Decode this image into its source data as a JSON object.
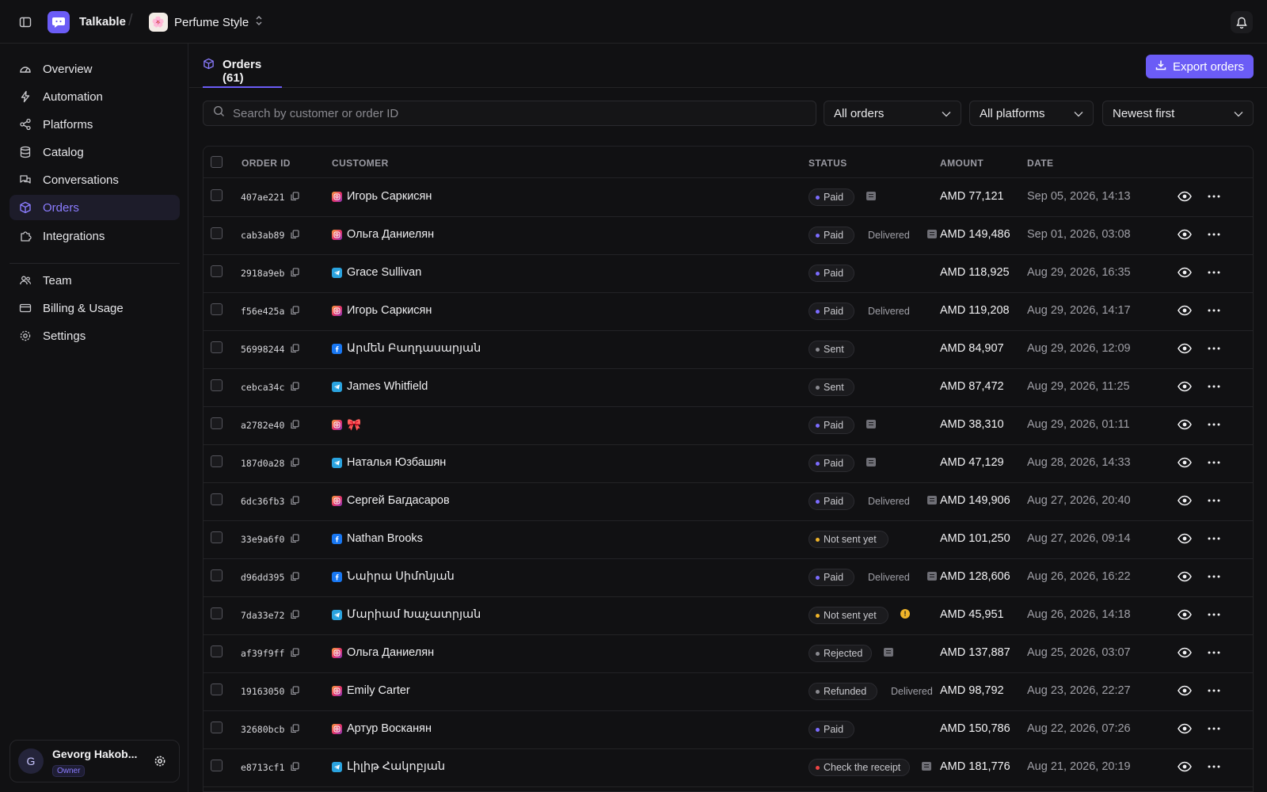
{
  "topbar": {
    "app_name": "Talkable",
    "store_name": "Perfume Style",
    "store_avatar": "🌸"
  },
  "sidebar": {
    "items": [
      {
        "label": "Overview",
        "icon": "gauge-icon"
      },
      {
        "label": "Automation",
        "icon": "bolt-icon"
      },
      {
        "label": "Platforms",
        "icon": "share-icon"
      },
      {
        "label": "Catalog",
        "icon": "database-icon"
      },
      {
        "label": "Conversations",
        "icon": "chat-icon"
      },
      {
        "label": "Orders",
        "icon": "box-icon",
        "active": true
      },
      {
        "label": "Integrations",
        "icon": "puzzle-icon"
      },
      {
        "label": "Team",
        "icon": "users-icon"
      },
      {
        "label": "Billing & Usage",
        "icon": "card-icon"
      },
      {
        "label": "Settings",
        "icon": "gear-icon"
      }
    ],
    "user": {
      "initial": "G",
      "name": "Gevorg Hakob...",
      "role": "Owner"
    }
  },
  "header": {
    "tab_label": "Orders (61)",
    "export_label": "Export orders"
  },
  "filters": {
    "search_placeholder": "Search by customer or order ID",
    "status_filter": "All orders",
    "platform_filter": "All platforms",
    "sort": "Newest first"
  },
  "table": {
    "columns": [
      "ORDER ID",
      "CUSTOMER",
      "STATUS",
      "AMOUNT",
      "DATE"
    ],
    "rows": [
      {
        "id": "407ae221",
        "platform": "instagram",
        "customer": "Игорь Саркисян",
        "status": "Paid",
        "delivered": "",
        "note": true,
        "warn": false,
        "amount": "AMD 77,121",
        "date": "Sep 05, 2026, 14:13"
      },
      {
        "id": "cab3ab89",
        "platform": "instagram",
        "customer": "Ольга Даниелян",
        "status": "Paid",
        "delivered": "Delivered",
        "note": true,
        "warn": false,
        "amount": "AMD 149,486",
        "date": "Sep 01, 2026, 03:08"
      },
      {
        "id": "2918a9eb",
        "platform": "telegram",
        "customer": "Grace Sullivan",
        "status": "Paid",
        "delivered": "",
        "note": false,
        "warn": false,
        "amount": "AMD 118,925",
        "date": "Aug 29, 2026, 16:35"
      },
      {
        "id": "f56e425a",
        "platform": "instagram",
        "customer": "Игорь Саркисян",
        "status": "Paid",
        "delivered": "Delivered",
        "note": false,
        "warn": false,
        "amount": "AMD 119,208",
        "date": "Aug 29, 2026, 14:17"
      },
      {
        "id": "56998244",
        "platform": "facebook",
        "customer": "Արմեն Բաղդասարյան",
        "status": "Sent",
        "delivered": "",
        "note": false,
        "warn": false,
        "amount": "AMD 84,907",
        "date": "Aug 29, 2026, 12:09"
      },
      {
        "id": "cebca34c",
        "platform": "telegram",
        "customer": "James Whitfield",
        "status": "Sent",
        "delivered": "",
        "note": false,
        "warn": false,
        "amount": "AMD 87,472",
        "date": "Aug 29, 2026, 11:25"
      },
      {
        "id": "a2782e40",
        "platform": "instagram",
        "customer": "🎀",
        "status": "Paid",
        "delivered": "",
        "note": true,
        "warn": false,
        "amount": "AMD 38,310",
        "date": "Aug 29, 2026, 01:11"
      },
      {
        "id": "187d0a28",
        "platform": "telegram",
        "customer": "Наталья Юзбашян",
        "status": "Paid",
        "delivered": "",
        "note": true,
        "warn": false,
        "amount": "AMD 47,129",
        "date": "Aug 28, 2026, 14:33"
      },
      {
        "id": "6dc36fb3",
        "platform": "instagram",
        "customer": "Сергей Багдасаров",
        "status": "Paid",
        "delivered": "Delivered",
        "note": true,
        "warn": false,
        "amount": "AMD 149,906",
        "date": "Aug 27, 2026, 20:40"
      },
      {
        "id": "33e9a6f0",
        "platform": "facebook",
        "customer": "Nathan Brooks",
        "status": "Not sent yet",
        "delivered": "",
        "note": false,
        "warn": false,
        "amount": "AMD 101,250",
        "date": "Aug 27, 2026, 09:14"
      },
      {
        "id": "d96dd395",
        "platform": "facebook",
        "customer": "Նաիրա Սիմոնյան",
        "status": "Paid",
        "delivered": "Delivered",
        "note": true,
        "warn": false,
        "amount": "AMD 128,606",
        "date": "Aug 26, 2026, 16:22"
      },
      {
        "id": "7da33e72",
        "platform": "telegram",
        "customer": "Մարիամ Խաչատրյան",
        "status": "Not sent yet",
        "delivered": "",
        "note": false,
        "warn": true,
        "amount": "AMD 45,951",
        "date": "Aug 26, 2026, 14:18"
      },
      {
        "id": "af39f9ff",
        "platform": "instagram",
        "customer": "Ольга Даниелян",
        "status": "Rejected",
        "delivered": "",
        "note": true,
        "warn": false,
        "amount": "AMD 137,887",
        "date": "Aug 25, 2026, 03:07"
      },
      {
        "id": "19163050",
        "platform": "instagram",
        "customer": "Emily Carter",
        "status": "Refunded",
        "delivered": "Delivered",
        "note": false,
        "warn": false,
        "amount": "AMD 98,792",
        "date": "Aug 23, 2026, 22:27"
      },
      {
        "id": "32680bcb",
        "platform": "instagram",
        "customer": "Артур Восканян",
        "status": "Paid",
        "delivered": "",
        "note": false,
        "warn": false,
        "amount": "AMD 150,786",
        "date": "Aug 22, 2026, 07:26"
      },
      {
        "id": "e8713cf1",
        "platform": "telegram",
        "customer": "Լիլիթ Հակոբյան",
        "status": "Check the receipt",
        "delivered": "",
        "note": true,
        "warn": false,
        "amount": "AMD 181,776",
        "date": "Aug 21, 2026, 20:19"
      }
    ]
  },
  "colors": {
    "accent": "#6b5cf6",
    "paid": "#7c6cff",
    "sent": "#8a8a90",
    "not_sent": "#f0b429",
    "rejected": "#8a8a90",
    "refunded": "#8a8a90",
    "check": "#ef4444"
  }
}
